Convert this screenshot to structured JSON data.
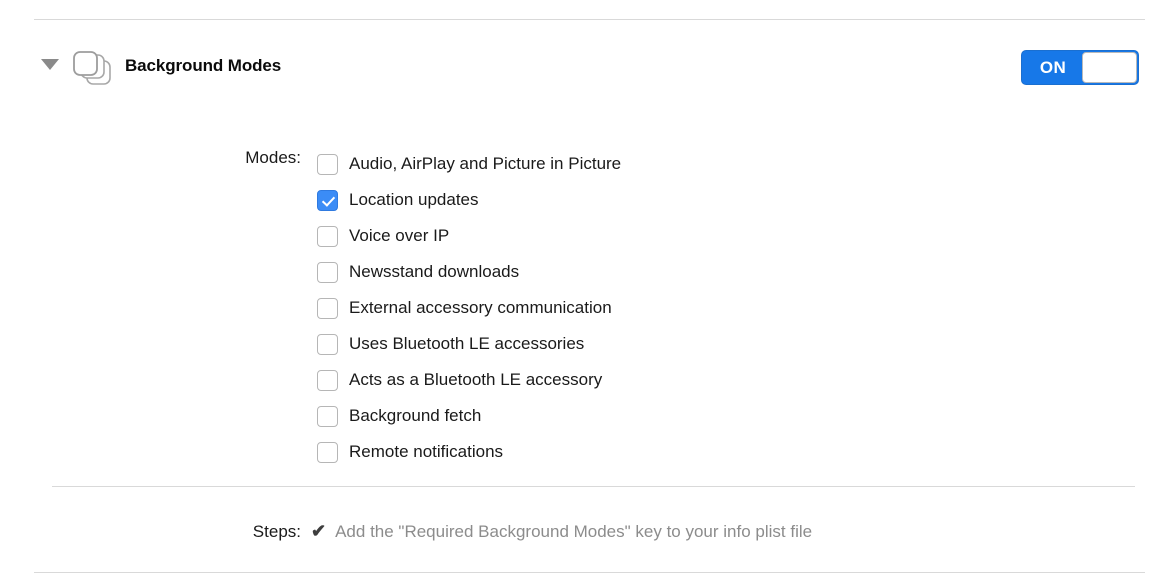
{
  "section": {
    "title": "Background Modes",
    "disclosure_icon": "triangle-down-icon",
    "capability_icon": "layered-squares-icon",
    "toggle": {
      "state_label": "ON",
      "enabled": true,
      "accent_color": "#1778e8"
    }
  },
  "modes": {
    "label": "Modes:",
    "checkbox_accent_color": "#3b8cf6",
    "items": [
      {
        "label": "Audio, AirPlay and Picture in Picture",
        "checked": false
      },
      {
        "label": "Location updates",
        "checked": true
      },
      {
        "label": "Voice over IP",
        "checked": false
      },
      {
        "label": "Newsstand downloads",
        "checked": false
      },
      {
        "label": "External accessory communication",
        "checked": false
      },
      {
        "label": "Uses Bluetooth LE accessories",
        "checked": false
      },
      {
        "label": "Acts as a Bluetooth LE accessory",
        "checked": false
      },
      {
        "label": "Background fetch",
        "checked": false
      },
      {
        "label": "Remote notifications",
        "checked": false
      }
    ]
  },
  "steps": {
    "label": "Steps:",
    "items": [
      {
        "check_icon": "checkmark-icon",
        "text": "Add the \"Required Background Modes\" key to your info plist file",
        "done": true
      }
    ]
  }
}
